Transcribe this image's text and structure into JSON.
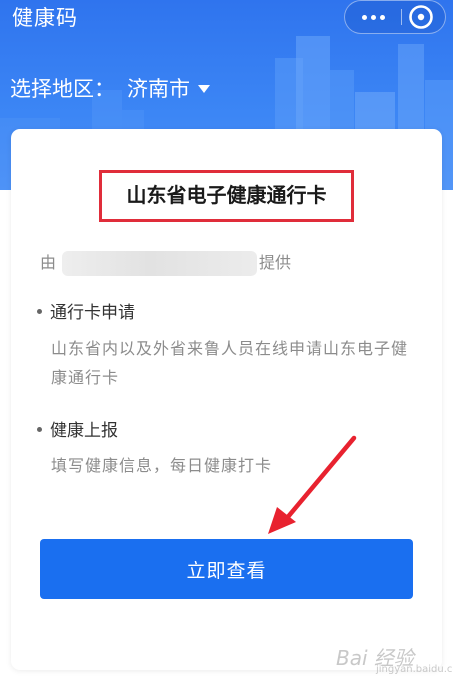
{
  "header": {
    "title": "健康码",
    "more_icon": "more-dots-icon",
    "close_icon": "close-circle-icon"
  },
  "region": {
    "label": "选择地区：",
    "value": "济南市",
    "dropdown_icon": "caret-down-icon"
  },
  "card": {
    "title": "山东省电子健康通行卡",
    "provider_prefix": "由",
    "provider_suffix": "提供",
    "sections": [
      {
        "heading": "通行卡申请",
        "description": "山东省内以及外省来鲁人员在线申请山东电子健康通行卡"
      },
      {
        "heading": "健康上报",
        "description": "填写健康信息，每日健康打卡"
      }
    ],
    "button_label": "立即查看"
  },
  "watermark": {
    "text": "Bai 经验",
    "subtext": "jingyan.baidu.com"
  },
  "colors": {
    "banner": "#2f74ee",
    "primary_button": "#1a6ff0",
    "highlight_box": "#e02d3a",
    "annotation_arrow": "#e8222f",
    "muted_text": "#8c8c8c"
  }
}
